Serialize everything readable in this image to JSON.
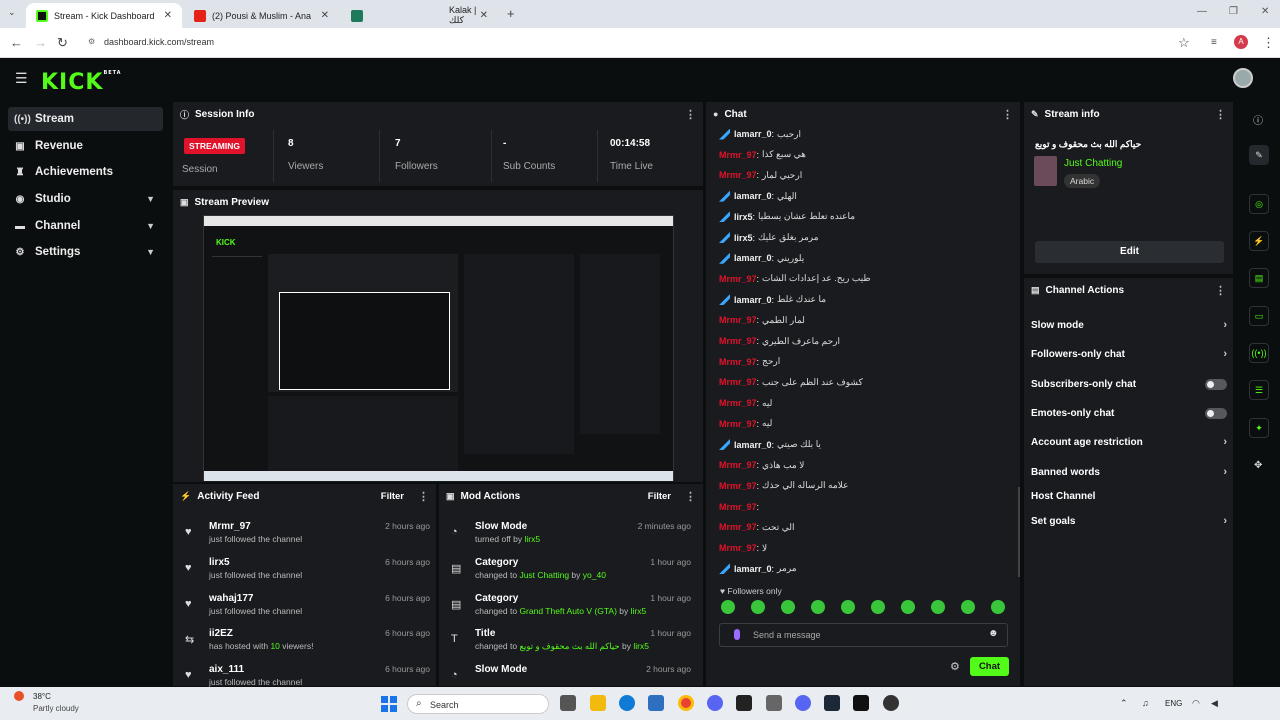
{
  "browser": {
    "tabs": [
      {
        "title": "Stream - Kick Dashboard",
        "active": true
      },
      {
        "title": "(2) Pousi & Muslim - Ana Bi...",
        "active": false
      },
      {
        "title": "Kalak | كلك",
        "active": false
      }
    ],
    "url": "dashboard.kick.com/stream",
    "profile_initial": "A"
  },
  "site": {
    "logo": "KICK",
    "logo_sup": "BETA"
  },
  "sidebar": {
    "items": [
      {
        "label": "Stream",
        "icon": "stream-icon"
      },
      {
        "label": "Revenue",
        "icon": "revenue-icon"
      },
      {
        "label": "Achievements",
        "icon": "trophy-icon"
      },
      {
        "label": "Studio",
        "icon": "studio-icon"
      },
      {
        "label": "Channel",
        "icon": "channel-icon"
      },
      {
        "label": "Settings",
        "icon": "gear-icon"
      }
    ]
  },
  "session": {
    "title": "Session Info",
    "status": "STREAMING",
    "status_label": "Session",
    "viewers": "8",
    "viewers_label": "Viewers",
    "followers": "7",
    "followers_label": "Followers",
    "subs": "-",
    "subs_label": "Sub Counts",
    "time": "00:14:58",
    "time_label": "Time Live"
  },
  "preview": {
    "title": "Stream Preview"
  },
  "activity": {
    "title": "Activity Feed",
    "filter": "Filter",
    "rows": [
      {
        "name": "Mrmr_97",
        "sub": "just followed the channel",
        "time": "2 hours ago"
      },
      {
        "name": "lirx5",
        "sub": "just followed the channel",
        "time": "6 hours ago"
      },
      {
        "name": "wahaj177",
        "sub": "just followed the channel",
        "time": "6 hours ago"
      },
      {
        "name": "ii2EZ",
        "sub_a": "has hosted with ",
        "sub_b": "10",
        "sub_c": " viewers!",
        "time": "6 hours ago"
      },
      {
        "name": "aix_111",
        "sub": "just followed the channel",
        "time": "6 hours ago"
      }
    ]
  },
  "mod": {
    "title": "Mod Actions",
    "filter": "Filter",
    "rows": [
      {
        "name": "Slow Mode",
        "a": "turned off by ",
        "b": "lirx5",
        "c": "",
        "d": "",
        "time": "2 minutes ago"
      },
      {
        "name": "Category",
        "a": "changed to ",
        "b": "Just Chatting",
        "c": " by ",
        "d": "yo_40",
        "time": "1 hour ago"
      },
      {
        "name": "Category",
        "a": "changed to ",
        "b": "Grand Theft Auto V (GTA)",
        "c": " by ",
        "d": "lirx5",
        "time": "1 hour ago"
      },
      {
        "name": "Title",
        "a": "changed to ",
        "b": "حياكم الله بث محقوف و تويع",
        "c": " by ",
        "d": "lirx5",
        "time": "1 hour ago"
      },
      {
        "name": "Slow Mode",
        "a": "",
        "b": "",
        "c": "",
        "d": "",
        "time": "2 hours ago"
      }
    ]
  },
  "chat": {
    "title": "Chat",
    "messages": [
      {
        "user": "lamarr_0",
        "text": "ارحبب",
        "color": "#f0f0f0",
        "badge": true
      },
      {
        "user": "Mrmr_97",
        "text": "هي سبع كذا",
        "color": "#e0132a",
        "badge": false
      },
      {
        "user": "Mrmr_97",
        "text": "ارحبي لمار",
        "color": "#e0132a",
        "badge": false
      },
      {
        "user": "lamarr_0",
        "text": "الهلي",
        "color": "#f0f0f0",
        "badge": true
      },
      {
        "user": "lirx5",
        "text": "ماعنده تعلط عشان يسطيا",
        "color": "#f0f0f0",
        "badge": true
      },
      {
        "user": "lirx5",
        "text": "مرمر بغلق عليك",
        "color": "#f0f0f0",
        "badge": true
      },
      {
        "user": "lamarr_0",
        "text": "يلوريني",
        "color": "#f0f0f0",
        "badge": true
      },
      {
        "user": "Mrmr_97",
        "text": "طيب ريح. عد إعدادات الشات",
        "color": "#e0132a",
        "badge": false
      },
      {
        "user": "lamarr_0",
        "text": "ما عندك غلط",
        "color": "#f0f0f0",
        "badge": true
      },
      {
        "user": "Mrmr_97",
        "text": "لمار الطمي",
        "color": "#e0132a",
        "badge": false
      },
      {
        "user": "Mrmr_97",
        "text": "ارحم ماعرف الطيري",
        "color": "#e0132a",
        "badge": false
      },
      {
        "user": "Mrmr_97",
        "text": "ارحج",
        "color": "#e0132a",
        "badge": false
      },
      {
        "user": "Mrmr_97",
        "text": "كشوف عند الظم على جنب",
        "color": "#e0132a",
        "badge": false
      },
      {
        "user": "Mrmr_97",
        "text": "ليه",
        "color": "#e0132a",
        "badge": false
      },
      {
        "user": "Mrmr_97",
        "text": "ليه",
        "color": "#e0132a",
        "badge": false
      },
      {
        "user": "lamarr_0",
        "text": "يا بلك صيتي",
        "color": "#f0f0f0",
        "badge": true
      },
      {
        "user": "Mrmr_97",
        "text": "لا مب هاذي",
        "color": "#e0132a",
        "badge": false
      },
      {
        "user": "Mrmr_97",
        "text": "علامه الرساله الي حذك",
        "color": "#e0132a",
        "badge": false
      },
      {
        "user": "Mrmr_97",
        "text": "",
        "color": "#e0132a",
        "badge": false
      },
      {
        "user": "Mrmr_97",
        "text": "الي تحت",
        "color": "#e0132a",
        "badge": false
      },
      {
        "user": "Mrmr_97",
        "text": "لا",
        "color": "#e0132a",
        "badge": false
      },
      {
        "user": "lamarr_0",
        "text": "مرمر",
        "color": "#f0f0f0",
        "badge": true
      }
    ],
    "followers_only": "Followers only",
    "placeholder": "Send a message",
    "send": "Chat"
  },
  "stream_info": {
    "title": "Stream info",
    "stream_title": "حياكم الله بث محقوف و تويع",
    "category": "Just Chatting",
    "language": "Arabic",
    "edit": "Edit"
  },
  "channel_actions": {
    "title": "Channel Actions",
    "items": [
      {
        "label": "Slow mode",
        "kind": "arrow"
      },
      {
        "label": "Followers-only chat",
        "kind": "arrow"
      },
      {
        "label": "Subscribers-only chat",
        "kind": "toggle"
      },
      {
        "label": "Emotes-only chat",
        "kind": "toggle"
      },
      {
        "label": "Account age restriction",
        "kind": "arrow"
      },
      {
        "label": "Banned words",
        "kind": "arrow"
      },
      {
        "label": "Host Channel",
        "kind": "none"
      },
      {
        "label": "Set goals",
        "kind": "arrow"
      }
    ]
  },
  "taskbar": {
    "weather_temp": "38°C",
    "weather_desc": "Partly cloudy",
    "search": "Search",
    "lang": "ENG"
  },
  "colors": {
    "accent": "#53fc18",
    "streaming": "#e0132a",
    "panel": "#191b1f",
    "bg": "#0b0e0f"
  }
}
